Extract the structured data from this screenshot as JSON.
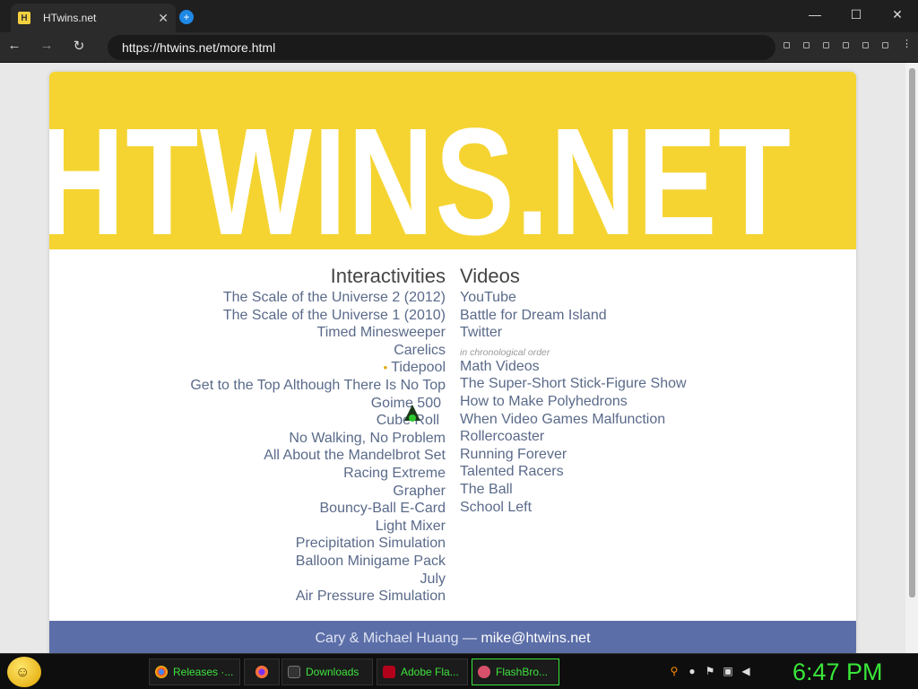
{
  "browser": {
    "tab_title": "HTwins.net",
    "tab_favicon": "H",
    "tab_close": "✕",
    "new_tab_icon": "+",
    "url": "https://htwins.net/more.html",
    "window_controls": {
      "minimize": "—",
      "maximize": "☐",
      "close": "✕"
    },
    "nav": {
      "back": "←",
      "forward": "→",
      "reload": "↻"
    }
  },
  "page": {
    "banner_title": "HTWINS.NET",
    "interactivities": {
      "heading": "Interactivities",
      "items": [
        "The Scale of the Universe 2 (2012)",
        "The Scale of the Universe 1 (2010)",
        "Timed Minesweeper",
        "Carelics",
        "Tidepool",
        "Get to the Top Although There Is No Top",
        "Goime 500",
        "Cube Roll",
        "No Walking, No Problem",
        "All About the Mandelbrot Set",
        "Racing Extreme",
        "Grapher",
        "Bouncy-Ball E-Card",
        "Light Mixer",
        "Precipitation Simulation",
        "Balloon Minigame Pack",
        "July",
        "Air Pressure Simulation"
      ],
      "marker": "•"
    },
    "videos": {
      "heading": "Videos",
      "links": [
        "YouTube",
        "Battle for Dream Island",
        "Twitter"
      ],
      "note": "in chronological order",
      "items": [
        "Math Videos",
        "The Super-Short Stick-Figure Show",
        "How to Make Polyhedrons",
        "When Video Games Malfunction",
        "Rollercoaster",
        "Running Forever",
        "Talented Racers",
        "The Ball",
        "School Left"
      ]
    },
    "footer": {
      "authors": "Cary & Michael Huang — ",
      "email": "mike@htwins.net"
    }
  },
  "taskbar": {
    "tasks": [
      "Releases ·...",
      "",
      "Downloads",
      "Adobe Fla...",
      "FlashBro..."
    ],
    "clock": "6:47 PM"
  },
  "colors": {
    "banner": "#f5d432",
    "link": "#5a6a8a",
    "footer": "#5b6ea8",
    "clock": "#39e639"
  }
}
